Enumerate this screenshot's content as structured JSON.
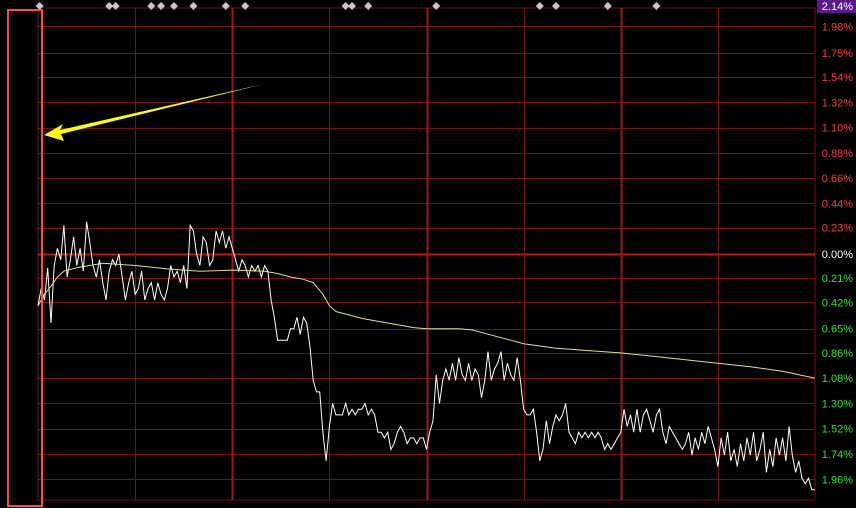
{
  "colors": {
    "background": "#000000",
    "grid": "#7a1010",
    "zero_line": "#c01818",
    "up_label": "#ff3b3b",
    "down_label": "#2ee82e",
    "zero_label": "#ffffff",
    "price_line": "#ffffff",
    "avg_line": "#e8e07a",
    "annotation_box": "#ff4a4a",
    "arrow": "#ffff00",
    "top_label_bg": "#5a1a8c"
  },
  "chart_data": {
    "type": "line",
    "title": "",
    "x_label": "",
    "y_label": "",
    "y_unit": "%",
    "ylim": [
      -2.14,
      2.14
    ],
    "grid": true,
    "top_label": "2.14%",
    "y_tick_labels": [
      {
        "value": 1.98,
        "label": "1.98%"
      },
      {
        "value": 1.75,
        "label": "1.75%"
      },
      {
        "value": 1.54,
        "label": "1.54%"
      },
      {
        "value": 1.32,
        "label": "1.32%"
      },
      {
        "value": 1.1,
        "label": "1.10%"
      },
      {
        "value": 0.88,
        "label": "0.88%"
      },
      {
        "value": 0.66,
        "label": "0.66%"
      },
      {
        "value": 0.44,
        "label": "0.44%"
      },
      {
        "value": 0.23,
        "label": "0.23%"
      },
      {
        "value": 0.0,
        "label": "0.00%"
      },
      {
        "value": -0.21,
        "label": "0.21%"
      },
      {
        "value": -0.42,
        "label": "0.42%"
      },
      {
        "value": -0.65,
        "label": "0.65%"
      },
      {
        "value": -0.86,
        "label": "0.86%"
      },
      {
        "value": -1.08,
        "label": "1.08%"
      },
      {
        "value": -1.3,
        "label": "1.30%"
      },
      {
        "value": -1.52,
        "label": "1.52%"
      },
      {
        "value": -1.74,
        "label": "1.74%"
      },
      {
        "value": -1.96,
        "label": "1.96%"
      }
    ],
    "x_range": [
      0,
      240
    ],
    "session_markers": [
      60,
      120,
      180
    ],
    "series": [
      {
        "key": "price",
        "points": [
          [
            0,
            -0.45
          ],
          [
            1,
            -0.3
          ],
          [
            2,
            -0.4
          ],
          [
            3,
            -0.12
          ],
          [
            4,
            -0.6
          ],
          [
            5,
            -0.1
          ],
          [
            6,
            0.05
          ],
          [
            7,
            -0.05
          ],
          [
            8,
            0.25
          ],
          [
            9,
            -0.2
          ],
          [
            10,
            -0.05
          ],
          [
            11,
            0.15
          ],
          [
            12,
            -0.1
          ],
          [
            13,
            0.05
          ],
          [
            14,
            -0.15
          ],
          [
            15,
            0.28
          ],
          [
            16,
            0.1
          ],
          [
            17,
            -0.1
          ],
          [
            18,
            -0.2
          ],
          [
            19,
            -0.05
          ],
          [
            20,
            -0.25
          ],
          [
            21,
            -0.4
          ],
          [
            22,
            -0.15
          ],
          [
            23,
            -0.05
          ],
          [
            24,
            -0.1
          ],
          [
            25,
            0.0
          ],
          [
            26,
            -0.2
          ],
          [
            27,
            -0.4
          ],
          [
            28,
            -0.25
          ],
          [
            29,
            -0.15
          ],
          [
            30,
            -0.35
          ],
          [
            31,
            -0.3
          ],
          [
            32,
            -0.15
          ],
          [
            33,
            -0.4
          ],
          [
            34,
            -0.3
          ],
          [
            35,
            -0.25
          ],
          [
            36,
            -0.4
          ],
          [
            37,
            -0.25
          ],
          [
            38,
            -0.35
          ],
          [
            39,
            -0.4
          ],
          [
            40,
            -0.3
          ],
          [
            41,
            -0.1
          ],
          [
            42,
            -0.2
          ],
          [
            43,
            -0.15
          ],
          [
            44,
            -0.25
          ],
          [
            45,
            -0.1
          ],
          [
            46,
            -0.3
          ],
          [
            47,
            0.25
          ],
          [
            48,
            0.2
          ],
          [
            49,
            0.0
          ],
          [
            50,
            -0.1
          ],
          [
            51,
            0.15
          ],
          [
            52,
            0.1
          ],
          [
            53,
            -0.1
          ],
          [
            54,
            -0.05
          ],
          [
            55,
            0.2
          ],
          [
            56,
            0.1
          ],
          [
            57,
            0.2
          ],
          [
            58,
            0.05
          ],
          [
            59,
            0.15
          ],
          [
            60,
            0.05
          ],
          [
            61,
            -0.05
          ],
          [
            62,
            -0.15
          ],
          [
            63,
            -0.05
          ],
          [
            64,
            -0.1
          ],
          [
            65,
            -0.2
          ],
          [
            66,
            -0.1
          ],
          [
            67,
            -0.15
          ],
          [
            68,
            -0.1
          ],
          [
            69,
            -0.2
          ],
          [
            70,
            -0.1
          ],
          [
            71,
            -0.15
          ],
          [
            72,
            -0.4
          ],
          [
            73,
            -0.55
          ],
          [
            74,
            -0.75
          ],
          [
            75,
            -0.75
          ],
          [
            76,
            -0.75
          ],
          [
            77,
            -0.75
          ],
          [
            78,
            -0.65
          ],
          [
            79,
            -0.65
          ],
          [
            80,
            -0.55
          ],
          [
            81,
            -0.7
          ],
          [
            82,
            -0.55
          ],
          [
            83,
            -0.6
          ],
          [
            84,
            -0.8
          ],
          [
            85,
            -1.1
          ],
          [
            86,
            -1.2
          ],
          [
            87,
            -1.2
          ],
          [
            88,
            -1.55
          ],
          [
            89,
            -1.8
          ],
          [
            90,
            -1.5
          ],
          [
            91,
            -1.3
          ],
          [
            92,
            -1.4
          ],
          [
            93,
            -1.4
          ],
          [
            94,
            -1.4
          ],
          [
            95,
            -1.3
          ],
          [
            96,
            -1.4
          ],
          [
            97,
            -1.35
          ],
          [
            98,
            -1.4
          ],
          [
            99,
            -1.35
          ],
          [
            100,
            -1.35
          ],
          [
            101,
            -1.3
          ],
          [
            102,
            -1.4
          ],
          [
            103,
            -1.35
          ],
          [
            104,
            -1.4
          ],
          [
            105,
            -1.55
          ],
          [
            106,
            -1.55
          ],
          [
            107,
            -1.6
          ],
          [
            108,
            -1.55
          ],
          [
            109,
            -1.7
          ],
          [
            110,
            -1.65
          ],
          [
            111,
            -1.55
          ],
          [
            112,
            -1.5
          ],
          [
            113,
            -1.55
          ],
          [
            114,
            -1.65
          ],
          [
            115,
            -1.6
          ],
          [
            116,
            -1.6
          ],
          [
            117,
            -1.65
          ],
          [
            118,
            -1.6
          ],
          [
            119,
            -1.6
          ],
          [
            120,
            -1.7
          ],
          [
            121,
            -1.55
          ],
          [
            122,
            -1.45
          ],
          [
            123,
            -1.05
          ],
          [
            124,
            -1.3
          ],
          [
            125,
            -1.1
          ],
          [
            126,
            -1.0
          ],
          [
            127,
            -1.1
          ],
          [
            128,
            -0.95
          ],
          [
            129,
            -1.1
          ],
          [
            130,
            -0.9
          ],
          [
            131,
            -1.05
          ],
          [
            132,
            -1.1
          ],
          [
            133,
            -0.95
          ],
          [
            134,
            -1.1
          ],
          [
            135,
            -1.0
          ],
          [
            136,
            -1.05
          ],
          [
            137,
            -1.25
          ],
          [
            138,
            -1.1
          ],
          [
            139,
            -0.85
          ],
          [
            140,
            -1.1
          ],
          [
            141,
            -1.0
          ],
          [
            142,
            -0.95
          ],
          [
            143,
            -0.85
          ],
          [
            144,
            -1.1
          ],
          [
            145,
            -0.95
          ],
          [
            146,
            -1.05
          ],
          [
            147,
            -1.1
          ],
          [
            148,
            -0.9
          ],
          [
            149,
            -1.1
          ],
          [
            150,
            -1.35
          ],
          [
            151,
            -1.4
          ],
          [
            152,
            -1.4
          ],
          [
            153,
            -1.35
          ],
          [
            154,
            -1.55
          ],
          [
            155,
            -1.8
          ],
          [
            156,
            -1.7
          ],
          [
            157,
            -1.45
          ],
          [
            158,
            -1.65
          ],
          [
            159,
            -1.5
          ],
          [
            160,
            -1.4
          ],
          [
            161,
            -1.45
          ],
          [
            162,
            -1.4
          ],
          [
            163,
            -1.3
          ],
          [
            164,
            -1.55
          ],
          [
            165,
            -1.6
          ],
          [
            166,
            -1.65
          ],
          [
            167,
            -1.55
          ],
          [
            168,
            -1.6
          ],
          [
            169,
            -1.55
          ],
          [
            170,
            -1.6
          ],
          [
            171,
            -1.55
          ],
          [
            172,
            -1.6
          ],
          [
            173,
            -1.55
          ],
          [
            174,
            -1.6
          ],
          [
            175,
            -1.7
          ],
          [
            176,
            -1.65
          ],
          [
            177,
            -1.7
          ],
          [
            178,
            -1.65
          ],
          [
            179,
            -1.6
          ],
          [
            180,
            -1.55
          ],
          [
            181,
            -1.35
          ],
          [
            182,
            -1.5
          ],
          [
            183,
            -1.4
          ],
          [
            184,
            -1.55
          ],
          [
            185,
            -1.35
          ],
          [
            186,
            -1.55
          ],
          [
            187,
            -1.4
          ],
          [
            188,
            -1.35
          ],
          [
            189,
            -1.45
          ],
          [
            190,
            -1.55
          ],
          [
            191,
            -1.4
          ],
          [
            192,
            -1.35
          ],
          [
            193,
            -1.55
          ],
          [
            194,
            -1.65
          ],
          [
            195,
            -1.5
          ],
          [
            196,
            -1.55
          ],
          [
            197,
            -1.6
          ],
          [
            198,
            -1.65
          ],
          [
            199,
            -1.7
          ],
          [
            200,
            -1.65
          ],
          [
            201,
            -1.55
          ],
          [
            202,
            -1.75
          ],
          [
            203,
            -1.6
          ],
          [
            204,
            -1.7
          ],
          [
            205,
            -1.55
          ],
          [
            206,
            -1.65
          ],
          [
            207,
            -1.5
          ],
          [
            208,
            -1.6
          ],
          [
            209,
            -1.7
          ],
          [
            210,
            -1.85
          ],
          [
            211,
            -1.6
          ],
          [
            212,
            -1.75
          ],
          [
            213,
            -1.55
          ],
          [
            214,
            -1.8
          ],
          [
            215,
            -1.7
          ],
          [
            216,
            -1.85
          ],
          [
            217,
            -1.65
          ],
          [
            218,
            -1.8
          ],
          [
            219,
            -1.6
          ],
          [
            220,
            -1.75
          ],
          [
            221,
            -1.55
          ],
          [
            222,
            -1.8
          ],
          [
            223,
            -1.7
          ],
          [
            224,
            -1.55
          ],
          [
            225,
            -1.9
          ],
          [
            226,
            -1.7
          ],
          [
            227,
            -1.85
          ],
          [
            228,
            -1.6
          ],
          [
            229,
            -1.75
          ],
          [
            230,
            -1.6
          ],
          [
            231,
            -1.8
          ],
          [
            232,
            -1.5
          ],
          [
            233,
            -1.75
          ],
          [
            234,
            -1.9
          ],
          [
            235,
            -1.8
          ],
          [
            236,
            -1.95
          ],
          [
            237,
            -2.0
          ],
          [
            238,
            -1.95
          ],
          [
            239,
            -2.05
          ],
          [
            240,
            -2.05
          ]
        ]
      },
      {
        "key": "average",
        "points": [
          [
            0,
            -0.45
          ],
          [
            2,
            -0.35
          ],
          [
            4,
            -0.28
          ],
          [
            6,
            -0.2
          ],
          [
            8,
            -0.15
          ],
          [
            12,
            -0.12
          ],
          [
            16,
            -0.1
          ],
          [
            20,
            -0.08
          ],
          [
            30,
            -0.1
          ],
          [
            40,
            -0.13
          ],
          [
            50,
            -0.15
          ],
          [
            60,
            -0.14
          ],
          [
            70,
            -0.15
          ],
          [
            74,
            -0.17
          ],
          [
            78,
            -0.2
          ],
          [
            82,
            -0.22
          ],
          [
            85,
            -0.25
          ],
          [
            88,
            -0.35
          ],
          [
            90,
            -0.45
          ],
          [
            92,
            -0.5
          ],
          [
            96,
            -0.53
          ],
          [
            100,
            -0.56
          ],
          [
            104,
            -0.58
          ],
          [
            108,
            -0.6
          ],
          [
            112,
            -0.62
          ],
          [
            116,
            -0.64
          ],
          [
            120,
            -0.65
          ],
          [
            130,
            -0.65
          ],
          [
            134,
            -0.66
          ],
          [
            138,
            -0.69
          ],
          [
            142,
            -0.72
          ],
          [
            146,
            -0.75
          ],
          [
            150,
            -0.78
          ],
          [
            155,
            -0.8
          ],
          [
            160,
            -0.82
          ],
          [
            165,
            -0.83
          ],
          [
            170,
            -0.84
          ],
          [
            175,
            -0.85
          ],
          [
            180,
            -0.86
          ],
          [
            190,
            -0.89
          ],
          [
            200,
            -0.92
          ],
          [
            210,
            -0.95
          ],
          [
            220,
            -0.98
          ],
          [
            230,
            -1.02
          ],
          [
            235,
            -1.05
          ],
          [
            240,
            -1.08
          ]
        ]
      }
    ],
    "top_markers": [
      0.5,
      22,
      24,
      35,
      38,
      42,
      48,
      58,
      64,
      95,
      97,
      102,
      123,
      155,
      160,
      176,
      191
    ]
  }
}
